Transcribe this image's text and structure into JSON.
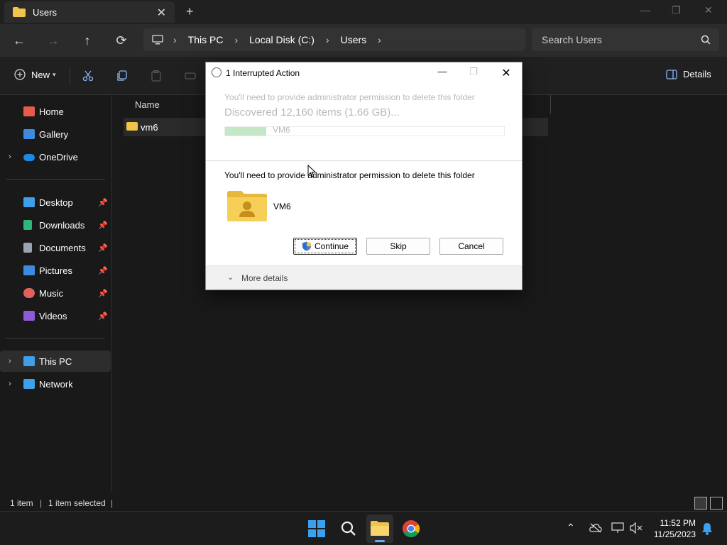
{
  "tab": {
    "title": "Users",
    "close_glyph": "✕",
    "new_tab_glyph": "+"
  },
  "window_controls": {
    "minimize": "—",
    "restore": "❐",
    "close": "✕"
  },
  "nav": {
    "back": "←",
    "forward": "→",
    "up": "↑",
    "refresh": "⟳",
    "breadcrumb": [
      "This PC",
      "Local Disk (C:)",
      "Users"
    ],
    "separator": "›",
    "search_placeholder": "Search Users"
  },
  "commandbar": {
    "new_label": "New",
    "details_label": "Details"
  },
  "sidebar": {
    "items": [
      {
        "label": "Home",
        "icon": "home-icon",
        "color": "#e85b4a"
      },
      {
        "label": "Gallery",
        "icon": "gallery-icon",
        "color": "#3c8be0"
      },
      {
        "label": "OneDrive",
        "icon": "onedrive-icon",
        "color": "#1e88e5"
      },
      {
        "label": "Desktop",
        "icon": "desktop-icon",
        "color": "#3ea0e8"
      },
      {
        "label": "Downloads",
        "icon": "downloads-icon",
        "color": "#2eb67d"
      },
      {
        "label": "Documents",
        "icon": "documents-icon",
        "color": "#9aa4b0"
      },
      {
        "label": "Pictures",
        "icon": "pictures-icon",
        "color": "#3c8be0"
      },
      {
        "label": "Music",
        "icon": "music-icon",
        "color": "#e0605a"
      },
      {
        "label": "Videos",
        "icon": "videos-icon",
        "color": "#8e5ad8"
      },
      {
        "label": "This PC",
        "icon": "this-pc-icon",
        "color": "#3ea0e8"
      },
      {
        "label": "Network",
        "icon": "network-icon",
        "color": "#3ea0e8"
      }
    ]
  },
  "filelist": {
    "column_name": "Name",
    "rows": [
      {
        "name": "vm6"
      }
    ]
  },
  "statusbar": {
    "count": "1 item",
    "selected": "1 item selected"
  },
  "dialog": {
    "title": "1 Interrupted Action",
    "ghost_line1": "You'll need to provide administrator permission to delete this folder",
    "ghost_line2": "Discovered 12,160 items (1.66 GB)...",
    "ghost_name": "VM6",
    "message": "You'll need to provide administrator permission to delete this folder",
    "folder_name": "VM6",
    "continue": "Continue",
    "skip": "Skip",
    "cancel": "Cancel",
    "more_details": "More details"
  },
  "taskbar": {
    "time": "11:52 PM",
    "date": "11/25/2023"
  }
}
